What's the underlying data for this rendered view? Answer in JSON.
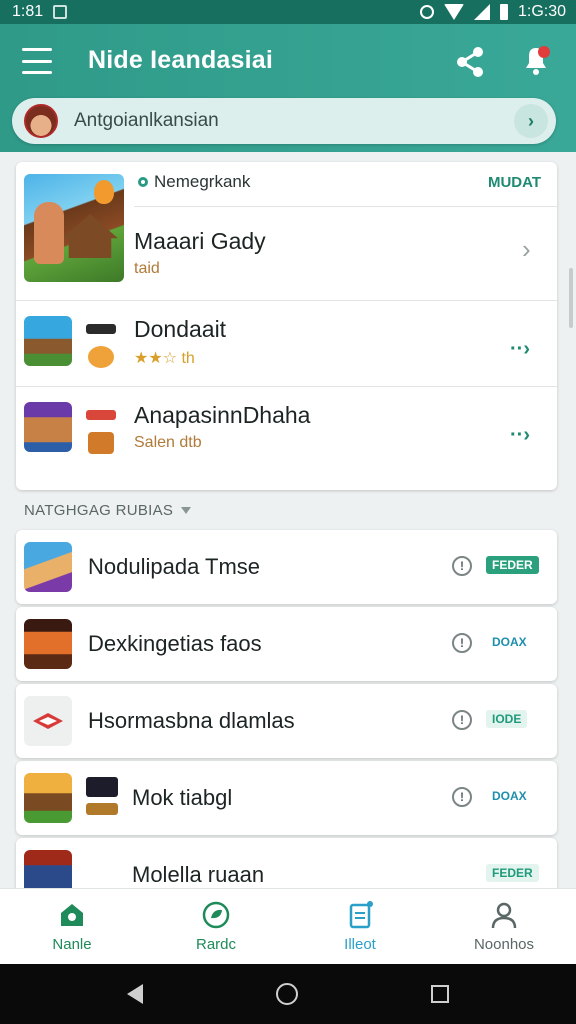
{
  "status_bar": {
    "time_left": "1:81",
    "time_right": "1:G:30"
  },
  "app_bar": {
    "title": "Nide Ieandasiai"
  },
  "search": {
    "text": "Antgoianlkansian"
  },
  "featured": {
    "tag": "Nemegrkank",
    "action": "MUDAT",
    "items": [
      {
        "title": "Maaari Gady",
        "subtitle": "taid"
      },
      {
        "title": "Dondaait",
        "subtitle": "★★☆ th"
      },
      {
        "title": "AnapasinnDhaha",
        "subtitle": "Salen dtb"
      }
    ]
  },
  "section": {
    "title": "NATGHGAG RUBIAS"
  },
  "list": [
    {
      "title": "Nodulipada Tmse",
      "badge": "FEDER",
      "badge_style": "solid"
    },
    {
      "title": "Dexkingetias faos",
      "badge": "DOAX",
      "badge_style": "text"
    },
    {
      "title": "Hsormasbna dlamlas",
      "badge": "IODE",
      "badge_style": "outline"
    },
    {
      "title": "Mok tiabgl",
      "badge": "DOAX",
      "badge_style": "text"
    },
    {
      "title": "Molella ruaan",
      "badge": "FEDER",
      "badge_style": "outline"
    }
  ],
  "bottom_nav": [
    {
      "label": "Nanle",
      "color": "#1f8a5a"
    },
    {
      "label": "Rardc",
      "color": "#1f8a5a"
    },
    {
      "label": "Illeot",
      "color": "#2aa0c8"
    },
    {
      "label": "Noonhos",
      "color": "#5b6666"
    }
  ],
  "colors": {
    "primary": "#2f9a88",
    "accent": "#1f8a72",
    "status": "#17705f"
  }
}
